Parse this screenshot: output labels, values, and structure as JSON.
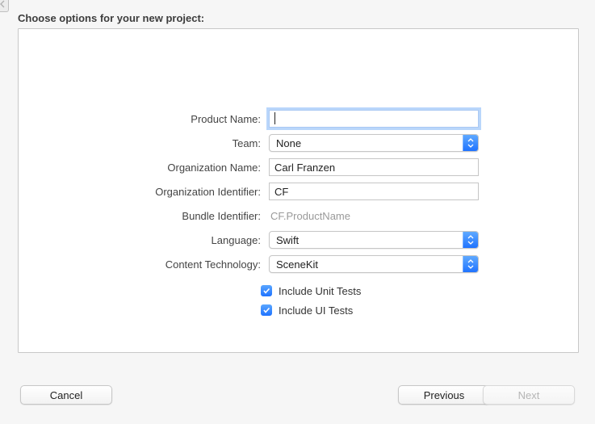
{
  "heading": "Choose options for your new project:",
  "labels": {
    "product_name": "Product Name:",
    "team": "Team:",
    "organization_name": "Organization Name:",
    "organization_identifier": "Organization Identifier:",
    "bundle_identifier": "Bundle Identifier:",
    "language": "Language:",
    "content_technology": "Content Technology:"
  },
  "values": {
    "product_name": "",
    "team": "None",
    "organization_name": "Carl Franzen",
    "organization_identifier": "CF",
    "bundle_identifier": "CF.ProductName",
    "language": "Swift",
    "content_technology": "SceneKit"
  },
  "checkboxes": {
    "include_unit_tests": {
      "label": "Include Unit Tests",
      "checked": true
    },
    "include_ui_tests": {
      "label": "Include UI Tests",
      "checked": true
    }
  },
  "buttons": {
    "cancel": "Cancel",
    "previous": "Previous",
    "next": "Next"
  }
}
